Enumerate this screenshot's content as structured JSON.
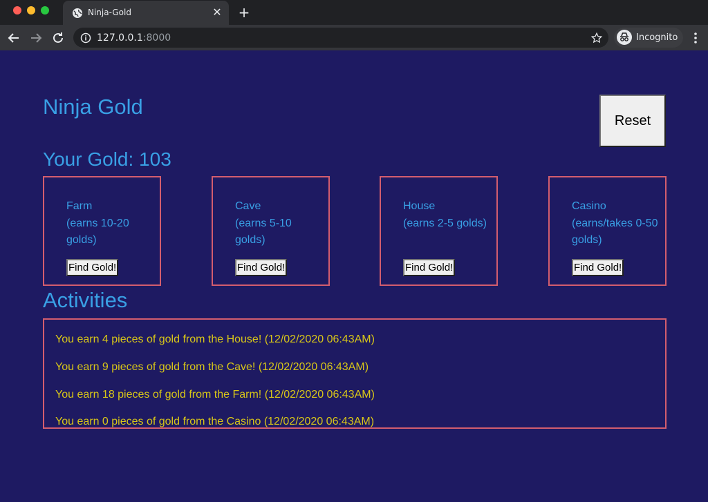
{
  "browser": {
    "tab_title": "Ninja-Gold",
    "url_host": "127.0.0.1",
    "url_port": ":8000",
    "profile_label": "Incognito"
  },
  "page": {
    "title": "Ninja Gold",
    "reset_label": "Reset",
    "gold_label": "Your Gold: 103",
    "cards": [
      {
        "name": "Farm",
        "desc": "(earns 10-20 golds)",
        "button": "Find Gold!"
      },
      {
        "name": "Cave",
        "desc": "(earns 5-10 golds)",
        "button": "Find Gold!"
      },
      {
        "name": "House",
        "desc": "(earns 2-5 golds)",
        "button": "Find Gold!"
      },
      {
        "name": "Casino",
        "desc": "(earns/takes 0-50 golds)",
        "button": "Find Gold!"
      }
    ],
    "activities_title": "Activities",
    "activities": [
      "You earn 4 pieces of gold from the House! (12/02/2020 06:43AM)",
      "You earn 9 pieces of gold from the Cave! (12/02/2020 06:43AM)",
      "You earn 18 pieces of gold from the Farm! (12/02/2020 06:43AM)",
      "You earn 0 pieces of gold from the Casino (12/02/2020 06:43AM)"
    ]
  },
  "colors": {
    "background": "#1e1a62",
    "heading": "#39a0e5",
    "border": "#d35d6e",
    "activity_text": "#d8c618"
  }
}
